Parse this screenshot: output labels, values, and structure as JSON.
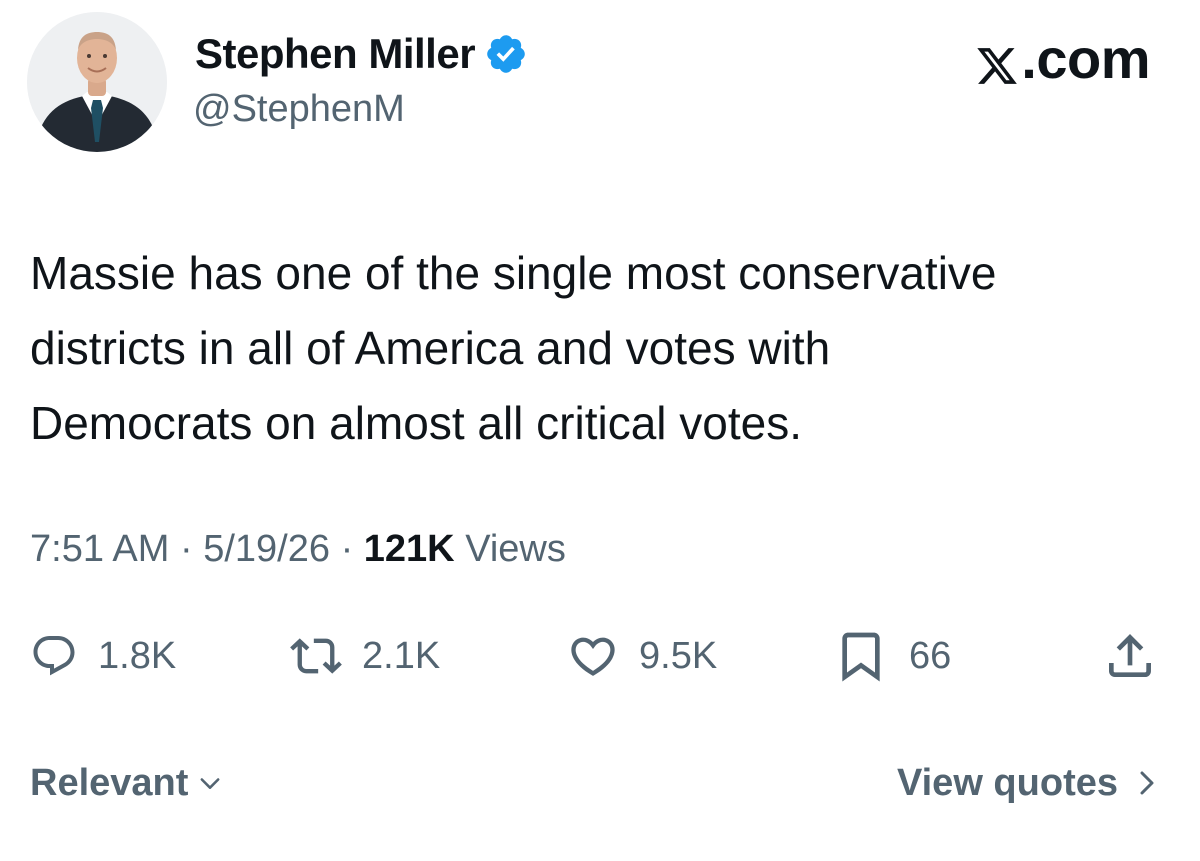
{
  "author": {
    "display_name": "Stephen Miller",
    "handle": "@StephenM",
    "verified_icon": "verified-badge-icon",
    "verified_color": "#1d9bf0"
  },
  "brand": {
    "suffix": ".com",
    "logo_icon": "x-logo-icon"
  },
  "tweet": {
    "lines": [
      "Massie has one of the single most conservative",
      "districts in all of America and votes with",
      "Democrats on almost all critical votes."
    ]
  },
  "meta": {
    "time": "7:51 AM",
    "separator": "·",
    "date": "5/19/26",
    "views_count": "121K",
    "views_label": "Views"
  },
  "actions": {
    "replies": {
      "icon": "reply-icon",
      "count": "1.8K"
    },
    "reposts": {
      "icon": "repost-icon",
      "count": "2.1K"
    },
    "likes": {
      "icon": "heart-icon",
      "count": "9.5K"
    },
    "bookmarks": {
      "icon": "bookmark-icon",
      "count": "66"
    },
    "share": {
      "icon": "share-icon"
    }
  },
  "footer": {
    "sort_label": "Relevant",
    "view_quotes_label": "View quotes"
  },
  "colors": {
    "text_primary": "#0f1419",
    "text_secondary": "#536471",
    "accent": "#1d9bf0"
  }
}
